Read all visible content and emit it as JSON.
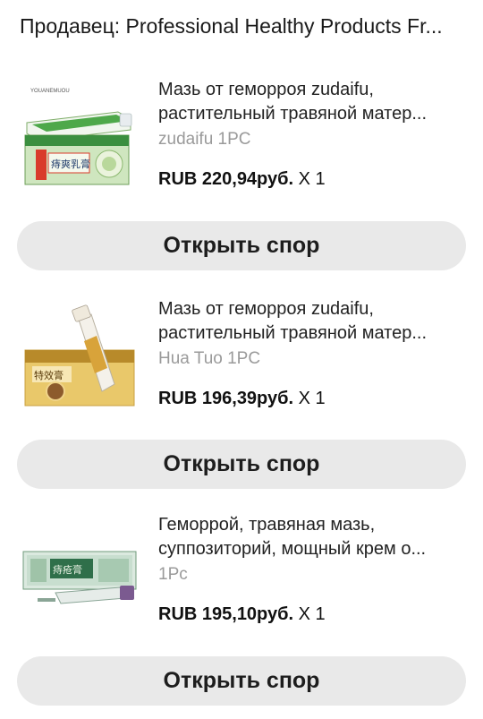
{
  "seller_line": "Продавец: Professional Healthy Products Fr...",
  "items": [
    {
      "title": "Мазь от геморроя zudaifu, растительный травяной матер...",
      "variant": "zudaifu 1PC",
      "price": "RUB 220,94руб.",
      "qty": "X 1",
      "button": "Открыть спор",
      "thumb_brand": "YOUANEMUOU",
      "thumb_text": "痔爽乳膏",
      "thumb_icon": "ointment-tube-green-box"
    },
    {
      "title": "Мазь от геморроя zudaifu, растительный травяной матер...",
      "variant": "Hua Tuo 1PC",
      "price": "RUB 196,39руб.",
      "qty": "X 1",
      "button": "Открыть спор",
      "thumb_text": "特效膏",
      "thumb_icon": "ointment-tube-gold-box"
    },
    {
      "title": "Геморрой, травяная мазь, суппозиторий, мощный крем о...",
      "variant": "1Pc",
      "price": "RUB 195,10руб.",
      "qty": "X 1",
      "button": "Открыть спор",
      "thumb_text": "痔疮膏",
      "thumb_icon": "ointment-tube-teal-box"
    }
  ]
}
